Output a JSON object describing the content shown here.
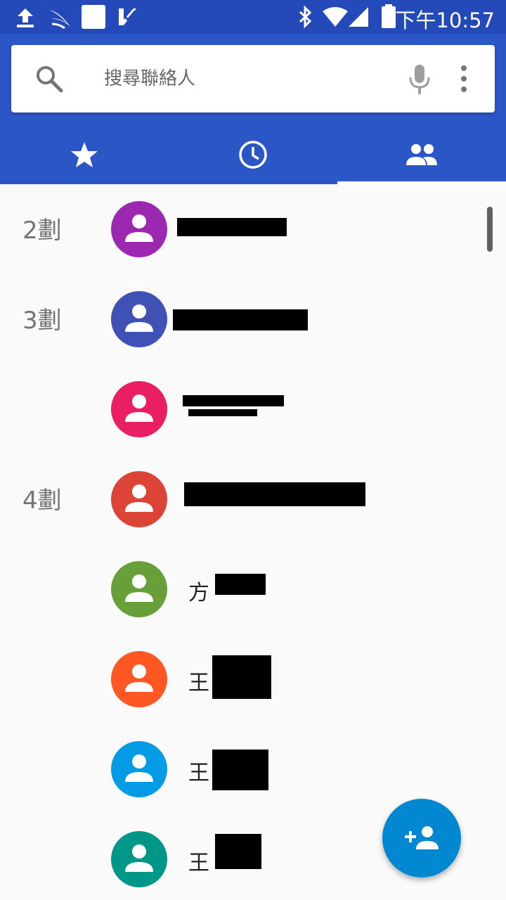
{
  "status_bar": {
    "time": "下午10:57",
    "icons": [
      "upload-icon",
      "app-logo-icon",
      "square-icon",
      "check-app-icon",
      "bluetooth-icon",
      "wifi-icon",
      "signal-icon",
      "battery-icon"
    ]
  },
  "search": {
    "placeholder": "搜尋聯絡人",
    "value": ""
  },
  "tabs": [
    {
      "name": "favorites",
      "icon": "star-icon",
      "selected": false
    },
    {
      "name": "recents",
      "icon": "clock-icon",
      "selected": false
    },
    {
      "name": "contacts",
      "icon": "people-icon",
      "selected": true
    }
  ],
  "contacts": [
    {
      "section": "2劃",
      "name": "",
      "color": "#9c27b0"
    },
    {
      "section": "3劃",
      "name": "",
      "color": "#3f51b5"
    },
    {
      "section": "",
      "name": "",
      "color": "#e91e63"
    },
    {
      "section": "4劃",
      "name": "",
      "color": "#db4437"
    },
    {
      "section": "",
      "name": "方",
      "color": "#689f38"
    },
    {
      "section": "",
      "name": "王",
      "color": "#ff5722"
    },
    {
      "section": "",
      "name": "王",
      "color": "#039be5"
    },
    {
      "section": "",
      "name": "王",
      "color": "#009688"
    }
  ],
  "colors": {
    "status_bar": "#2449b8",
    "app_bar": "#2a56c6",
    "fab": "#0288d1"
  },
  "fab": {
    "icon": "add-person-icon"
  }
}
